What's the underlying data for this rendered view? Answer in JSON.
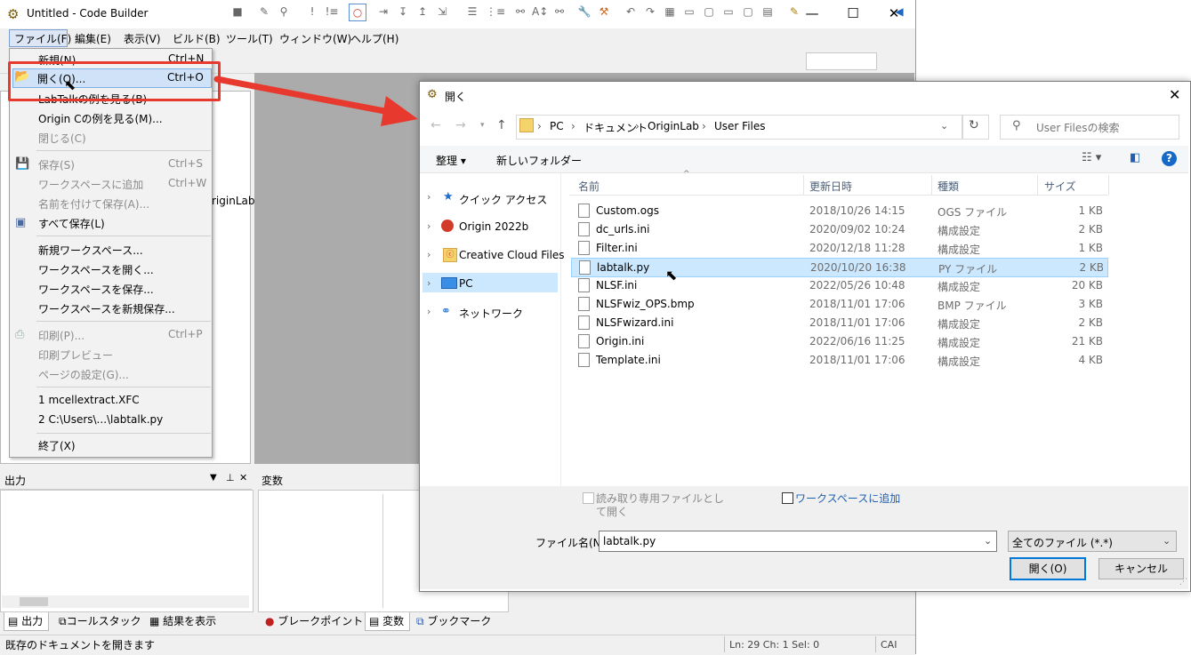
{
  "window": {
    "title": "Untitled - Code Builder",
    "min": "—",
    "max": "☐",
    "close": "✕"
  },
  "menubar": [
    "ファイル(F)",
    "編集(E)",
    "表示(V)",
    "ビルド(B)",
    "ツール(T)",
    "ウィンドウ(W)",
    "ヘルプ(H)"
  ],
  "file_menu": {
    "items": [
      {
        "label": "新規(N)...",
        "shortcut": "Ctrl+N",
        "disabled": false
      },
      {
        "label": "開く(O)...",
        "shortcut": "Ctrl+O",
        "disabled": false
      },
      {
        "label": "LabTalkの例を見る(B)",
        "shortcut": "",
        "disabled": false
      },
      {
        "label": "Origin Cの例を見る(M)...",
        "shortcut": "",
        "disabled": false
      },
      {
        "label": "閉じる(C)",
        "shortcut": "",
        "disabled": true
      },
      {
        "label": "保存(S)",
        "shortcut": "Ctrl+S",
        "disabled": true
      },
      {
        "label": "ワークスペースに追加",
        "shortcut": "Ctrl+W",
        "disabled": true
      },
      {
        "label": "名前を付けて保存(A)...",
        "shortcut": "",
        "disabled": true
      },
      {
        "label": "すべて保存(L)",
        "shortcut": "",
        "disabled": false
      },
      {
        "label": "新規ワークスペース...",
        "shortcut": "",
        "disabled": false
      },
      {
        "label": "ワークスペースを開く...",
        "shortcut": "",
        "disabled": false
      },
      {
        "label": "ワークスペースを保存...",
        "shortcut": "",
        "disabled": false
      },
      {
        "label": "ワークスペースを新規保存...",
        "shortcut": "",
        "disabled": false
      },
      {
        "label": "印刷(P)...",
        "shortcut": "Ctrl+P",
        "disabled": true
      },
      {
        "label": "印刷プレビュー",
        "shortcut": "",
        "disabled": true
      },
      {
        "label": "ページの設定(G)...",
        "shortcut": "",
        "disabled": true
      },
      {
        "label": "1 mcellextract.XFC",
        "shortcut": "",
        "disabled": false
      },
      {
        "label": "2 C:\\Users\\...\\labtalk.py",
        "shortcut": "",
        "disabled": false
      },
      {
        "label": "終了(X)",
        "shortcut": "",
        "disabled": false
      }
    ]
  },
  "left_panel_fragment": "riginLab¥",
  "panels": {
    "output_title": "出力",
    "variables_title": "変数"
  },
  "bottom_tabs_left": [
    "出力",
    "コールスタック",
    "結果を表示"
  ],
  "bottom_tabs_right": [
    "ブレークポイント",
    "変数",
    "ブックマーク"
  ],
  "status": {
    "text": "既存のドキュメントを開きます",
    "position": "Ln: 29 Ch: 1 Sel: 0",
    "caps": "CAI"
  },
  "dialog": {
    "title": "開く",
    "breadcrumb": [
      "PC",
      "ドキュメント",
      "OriginLab",
      "User Files"
    ],
    "search_placeholder": "User Filesの検索",
    "organize": "整理 ▾",
    "new_folder": "新しいフォルダー",
    "nav": [
      "クイック アクセス",
      "Origin 2022b",
      "Creative Cloud Files",
      "PC",
      "ネットワーク"
    ],
    "columns": [
      "名前",
      "更新日時",
      "種類",
      "サイズ"
    ],
    "files": [
      {
        "name": "Custom.ogs",
        "date": "2018/10/26 14:15",
        "type": "OGS ファイル",
        "size": "1 KB"
      },
      {
        "name": "dc_urls.ini",
        "date": "2020/09/02 10:24",
        "type": "構成設定",
        "size": "2 KB"
      },
      {
        "name": "Filter.ini",
        "date": "2020/12/18 11:28",
        "type": "構成設定",
        "size": "1 KB"
      },
      {
        "name": "labtalk.py",
        "date": "2020/10/20 16:38",
        "type": "PY ファイル",
        "size": "2 KB"
      },
      {
        "name": "NLSF.ini",
        "date": "2022/05/26 10:48",
        "type": "構成設定",
        "size": "20 KB"
      },
      {
        "name": "NLSFwiz_OPS.bmp",
        "date": "2018/11/01 17:06",
        "type": "BMP ファイル",
        "size": "3 KB"
      },
      {
        "name": "NLSFwizard.ini",
        "date": "2018/11/01 17:06",
        "type": "構成設定",
        "size": "2 KB"
      },
      {
        "name": "Origin.ini",
        "date": "2022/06/16 11:25",
        "type": "構成設定",
        "size": "21 KB"
      },
      {
        "name": "Template.ini",
        "date": "2018/11/01 17:06",
        "type": "構成設定",
        "size": "4 KB"
      }
    ],
    "readonly_label_1": "読み取り専用ファイルとし",
    "readonly_label_2": "て開く",
    "add_workspace": "ワークスペースに追加",
    "filename_label": "ファイル名(N):",
    "filename_value": "labtalk.py",
    "filetype_value": "全てのファイル (*.*)",
    "open_button": "開く(O)",
    "cancel_button": "キャンセル"
  },
  "colors": {
    "highlight_red": "#e8392f",
    "selection_blue": "#cce8ff",
    "menu_hover": "#cfe2f7"
  }
}
